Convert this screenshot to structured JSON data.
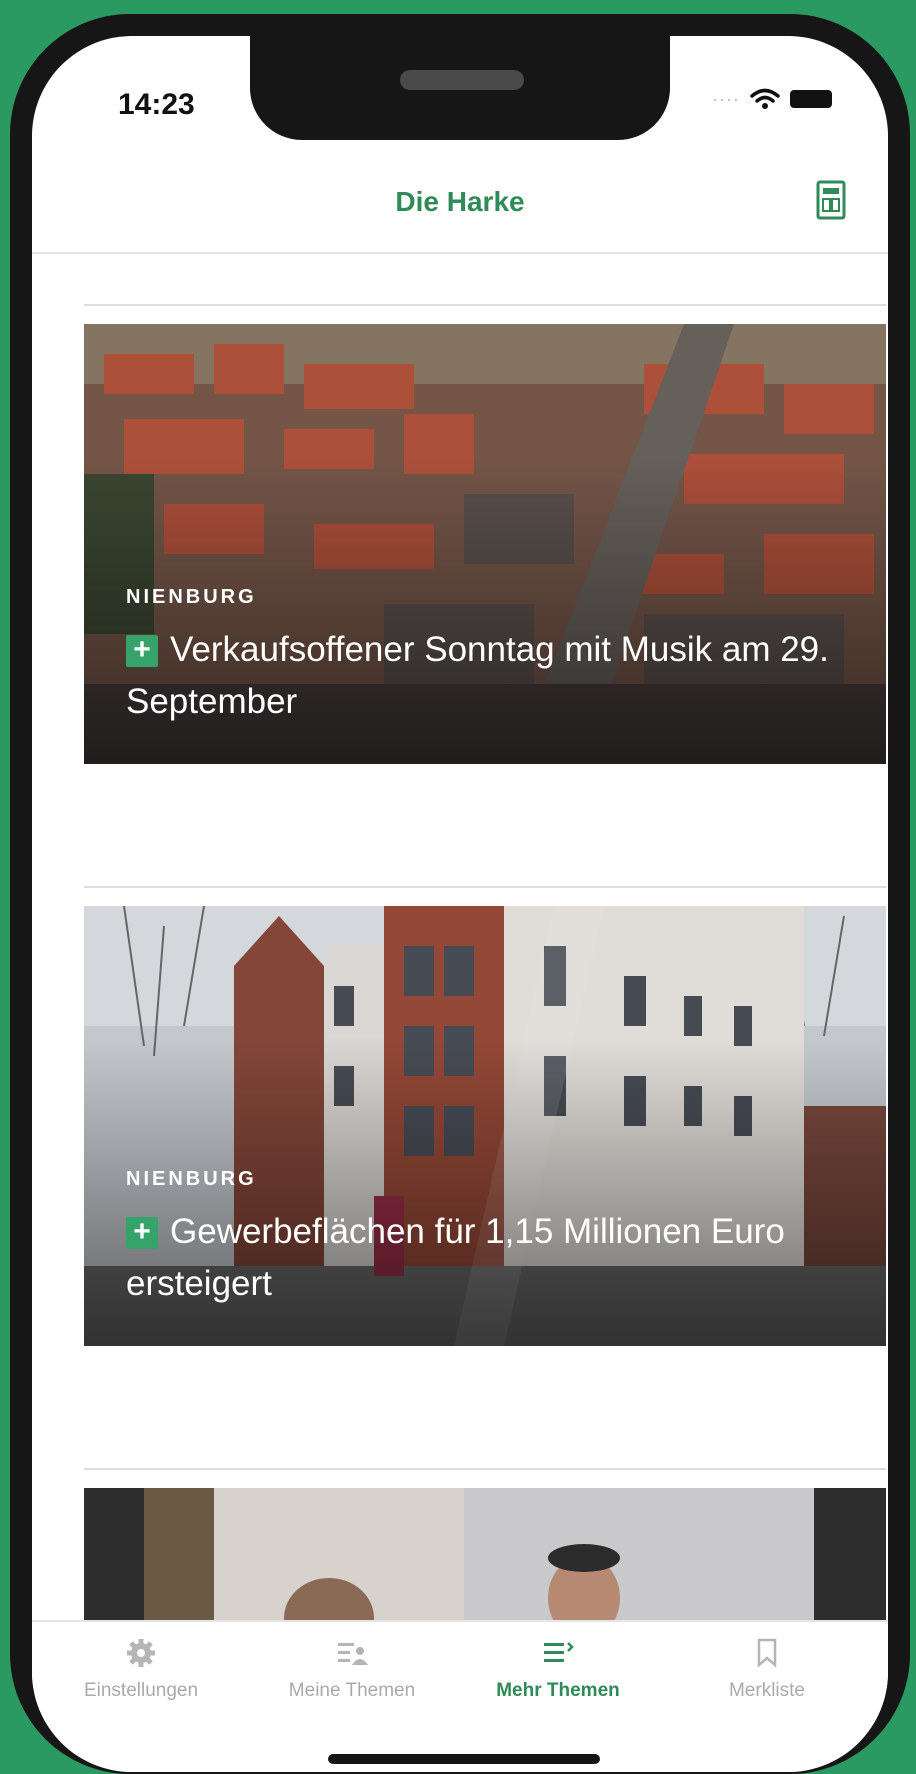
{
  "status_bar": {
    "time": "14:23"
  },
  "header": {
    "title": "Die Harke"
  },
  "articles": [
    {
      "section": "NIENBURG",
      "title": "Verkaufsoffener Sonntag mit Musik am 29. September"
    },
    {
      "section": "NIENBURG",
      "title": "Gewerbeflächen für 1,15 Millionen Euro ersteigert"
    }
  ],
  "tabs": [
    {
      "label": "Einstellungen",
      "icon": "gear-icon"
    },
    {
      "label": "Meine Themen",
      "icon": "my-topics-icon"
    },
    {
      "label": "Mehr Themen",
      "icon": "more-topics-icon",
      "active": true
    },
    {
      "label": "Merkliste",
      "icon": "bookmark-icon"
    }
  ],
  "colors": {
    "accent": "#2e8b57",
    "frame_bg": "#2b9a62",
    "plus_badge": "#36a36b"
  }
}
